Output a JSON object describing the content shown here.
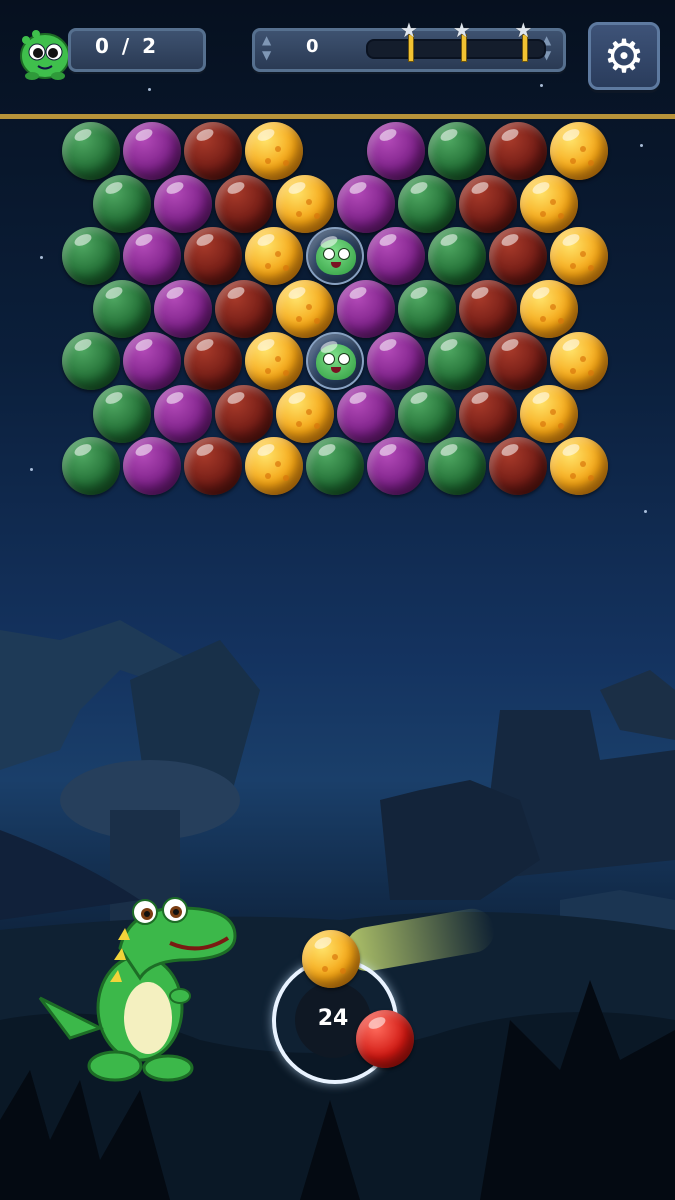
{
  "hud": {
    "rescue_counter": "0 / 2",
    "score": "0",
    "progress_fraction": 0.0,
    "star_markers_at": [
      0.25,
      0.55,
      0.9
    ],
    "settings_icon": "gear-icon",
    "rescue_icon": "baby-dino-icon"
  },
  "board": {
    "rows": [
      [
        "green",
        "purple",
        "red",
        "yellow",
        "",
        "purple",
        "green",
        "red",
        "yellow"
      ],
      [
        "green",
        "purple",
        "red",
        "yellow",
        "purple",
        "green",
        "red",
        "yellow"
      ],
      [
        "green",
        "purple",
        "red",
        "yellow",
        "dino",
        "purple",
        "green",
        "red",
        "yellow"
      ],
      [
        "green",
        "purple",
        "red",
        "yellow",
        "purple",
        "green",
        "red",
        "yellow"
      ],
      [
        "green",
        "purple",
        "red",
        "yellow",
        "dino",
        "purple",
        "green",
        "red",
        "yellow"
      ],
      [
        "green",
        "purple",
        "red",
        "yellow",
        "purple",
        "green",
        "red",
        "yellow"
      ],
      [
        "green",
        "purple",
        "red",
        "yellow",
        "green",
        "purple",
        "green",
        "red",
        "yellow"
      ]
    ]
  },
  "launcher": {
    "shots_left": "24",
    "current_bubble": "yellow",
    "next_bubble": "red-glossy"
  },
  "colors": {
    "hud_line": "#b8933a",
    "progress_fill": "#f1c232",
    "green": "#1f6a32",
    "purple": "#7a1f86",
    "red": "#6e1a14",
    "yellow": "#f5a414"
  }
}
